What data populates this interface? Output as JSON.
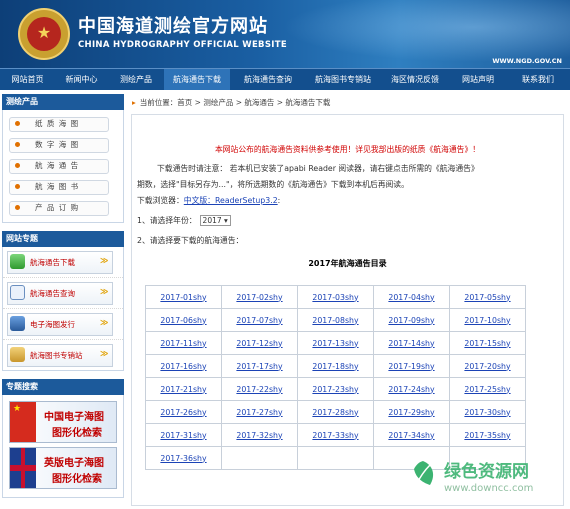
{
  "header": {
    "title": "中国海道测绘官方网站",
    "subtitle": "CHINA HYDROGRAPHY OFFICIAL WEBSITE",
    "url": "WWW.NGD.GOV.CN"
  },
  "nav": {
    "items": [
      "网站首页",
      "新闻中心",
      "测绘产品",
      "航海通告下载",
      "航海通告查询",
      "航海图书专销站",
      "海区情况反馈",
      "网站声明",
      "联系我们"
    ],
    "active_index": 3
  },
  "sidebar": {
    "products_title": "测绘产品",
    "products": [
      "纸 质 海 图",
      "数 字 海 图",
      "航 海 通 告",
      "航 海 图 书",
      "产 品 订 购"
    ],
    "specials_title": "网站专题",
    "specials": [
      "航海通告下载",
      "航海通告查询",
      "电子海图发行",
      "航海图书专销站"
    ],
    "special_arrow": "≫",
    "search_title": "专题搜索",
    "banners": [
      {
        "line1": "中国电子海图",
        "line2": "图形化检索"
      },
      {
        "line1": "英版电子海图",
        "line2": "图形化检索"
      }
    ]
  },
  "breadcrumb": {
    "arrow": "▸",
    "text": "当前位置：首页 > 测绘产品 > 航海通告 > 航海通告下载"
  },
  "content": {
    "notice": "本网站公布的航海通告资料供参考使用！详见我部出版的纸质《航海通告》！",
    "instruction_line1": "下载通告时请注意： 若本机已安装了apabi Reader 阅读器，请右键点击所需的《航海通告》",
    "instruction_line2": "期数，选择\"目标另存为...\"，将所选期数的《航海通告》下载到本机后再阅读。",
    "browser_label": "下载浏览器：",
    "browser_link": "中文版：ReaderSetup3.2",
    "browser_suffix": ":",
    "step1": "1、请选择年份：",
    "year": "2017 ▾",
    "step2": "2、请选择要下载的航海通告：",
    "table_title": "2017年航海通告目录",
    "files": [
      [
        "2017-01shy",
        "2017-02shy",
        "2017-03shy",
        "2017-04shy",
        "2017-05shy"
      ],
      [
        "2017-06shy",
        "2017-07shy",
        "2017-08shy",
        "2017-09shy",
        "2017-10shy"
      ],
      [
        "2017-11shy",
        "2017-12shy",
        "2017-13shy",
        "2017-14shy",
        "2017-15shy"
      ],
      [
        "2017-16shy",
        "2017-17shy",
        "2017-18shy",
        "2017-19shy",
        "2017-20shy"
      ],
      [
        "2017-21shy",
        "2017-22shy",
        "2017-23shy",
        "2017-24shy",
        "2017-25shy"
      ],
      [
        "2017-26shy",
        "2017-27shy",
        "2017-28shy",
        "2017-29shy",
        "2017-30shy"
      ],
      [
        "2017-31shy",
        "2017-32shy",
        "2017-33shy",
        "2017-34shy",
        "2017-35shy"
      ],
      [
        "2017-36shy",
        "",
        "",
        "",
        ""
      ]
    ]
  },
  "watermark": {
    "text": "绿色资源网",
    "url": "www.downcc.com"
  }
}
